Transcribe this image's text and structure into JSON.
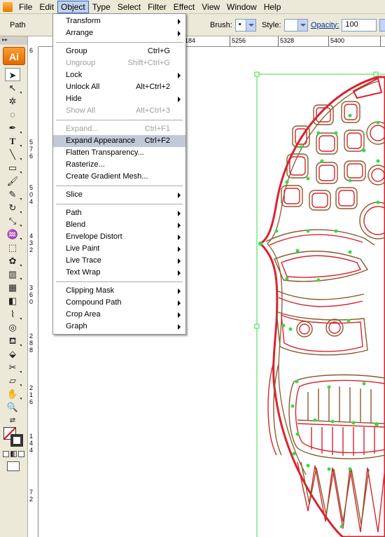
{
  "menubar": {
    "items": [
      {
        "label": "File"
      },
      {
        "label": "Edit"
      },
      {
        "label": "Object"
      },
      {
        "label": "Type"
      },
      {
        "label": "Select"
      },
      {
        "label": "Filter"
      },
      {
        "label": "Effect"
      },
      {
        "label": "View"
      },
      {
        "label": "Window"
      },
      {
        "label": "Help"
      }
    ]
  },
  "controlbar": {
    "selection_type": "Path",
    "brush_label": "Brush:",
    "brush_value": "•",
    "style_label": "Style:",
    "opacity_label": "Opacity:",
    "opacity_value": "100"
  },
  "ruler": {
    "h_labels": [
      "184",
      "5256",
      "5328",
      "5400"
    ],
    "v_labels": [
      "6",
      "5 7 6",
      "5 0 4",
      "4 3 2",
      "3 6 0",
      "2 8 8",
      "2 1 6",
      "1 4 4",
      "7 2"
    ]
  },
  "tools": {
    "logo": "Ai"
  },
  "object_menu": {
    "groups": [
      [
        {
          "label": "Transform",
          "submenu": true
        },
        {
          "label": "Arrange",
          "submenu": true
        }
      ],
      [
        {
          "label": "Group",
          "shortcut": "Ctrl+G"
        },
        {
          "label": "Ungroup",
          "shortcut": "Shift+Ctrl+G",
          "disabled": true
        },
        {
          "label": "Lock",
          "submenu": true
        },
        {
          "label": "Unlock All",
          "shortcut": "Alt+Ctrl+2"
        },
        {
          "label": "Hide",
          "submenu": true
        },
        {
          "label": "Show All",
          "shortcut": "Alt+Ctrl+3",
          "disabled": true
        }
      ],
      [
        {
          "label": "Expand...",
          "shortcut": "Ctrl+F1",
          "disabled": true
        },
        {
          "label": "Expand Appearance",
          "shortcut": "Ctrl+F2",
          "highlight": true
        },
        {
          "label": "Flatten Transparency..."
        },
        {
          "label": "Rasterize..."
        },
        {
          "label": "Create Gradient Mesh..."
        }
      ],
      [
        {
          "label": "Slice",
          "submenu": true
        }
      ],
      [
        {
          "label": "Path",
          "submenu": true
        },
        {
          "label": "Blend",
          "submenu": true
        },
        {
          "label": "Envelope Distort",
          "submenu": true
        },
        {
          "label": "Live Paint",
          "submenu": true
        },
        {
          "label": "Live Trace",
          "submenu": true
        },
        {
          "label": "Text Wrap",
          "submenu": true
        }
      ],
      [
        {
          "label": "Clipping Mask",
          "submenu": true
        },
        {
          "label": "Compound Path",
          "submenu": true
        },
        {
          "label": "Crop Area",
          "submenu": true
        },
        {
          "label": "Graph",
          "submenu": true
        }
      ]
    ]
  },
  "colors": {
    "menu_highlight": "#c1c8d8",
    "stroke_red": "#d9232e",
    "stroke_brown": "#8a5a2b",
    "selection_green": "#33dd44"
  }
}
